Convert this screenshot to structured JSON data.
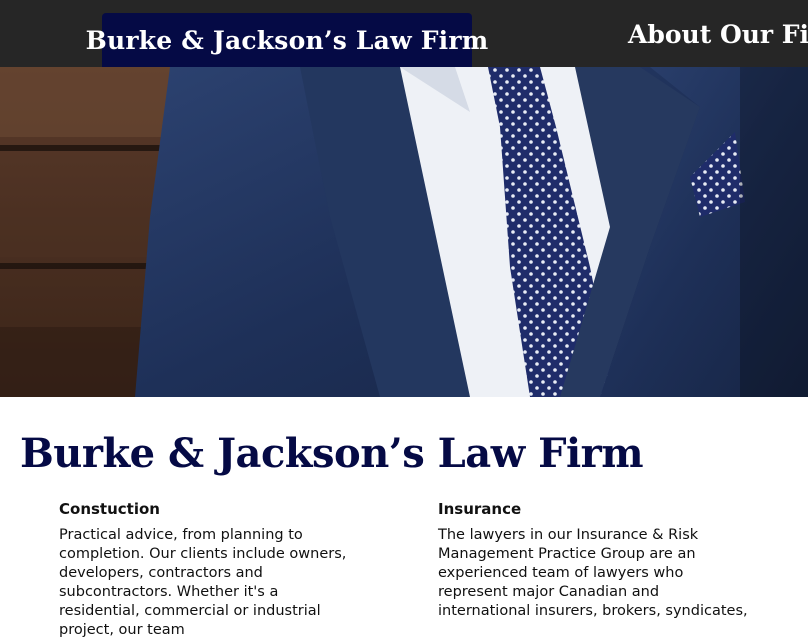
{
  "header": {
    "brand": "Burke & Jackson’s Law Firm",
    "nav_about": "About Our Firm"
  },
  "hero": {
    "image": "man-in-navy-suit-polka-dot-tie"
  },
  "main": {
    "title": "Burke & Jackson’s Law Firm",
    "columns": [
      {
        "heading": "Constuction",
        "text": "Practical advice, from planning to completion. Our clients include owners, developers, contractors and subcontractors. Whether it's a residential, commercial or industrial project, our team"
      },
      {
        "heading": "Insurance",
        "text": "The lawyers in our Insurance & Risk Management Practice Group are an experienced team of lawyers who represent major Canadian and international insurers, brokers, syndicates,"
      }
    ]
  },
  "colors": {
    "nav_bg": "#262626",
    "brand_bg": "#050a45",
    "title": "#050a45"
  }
}
